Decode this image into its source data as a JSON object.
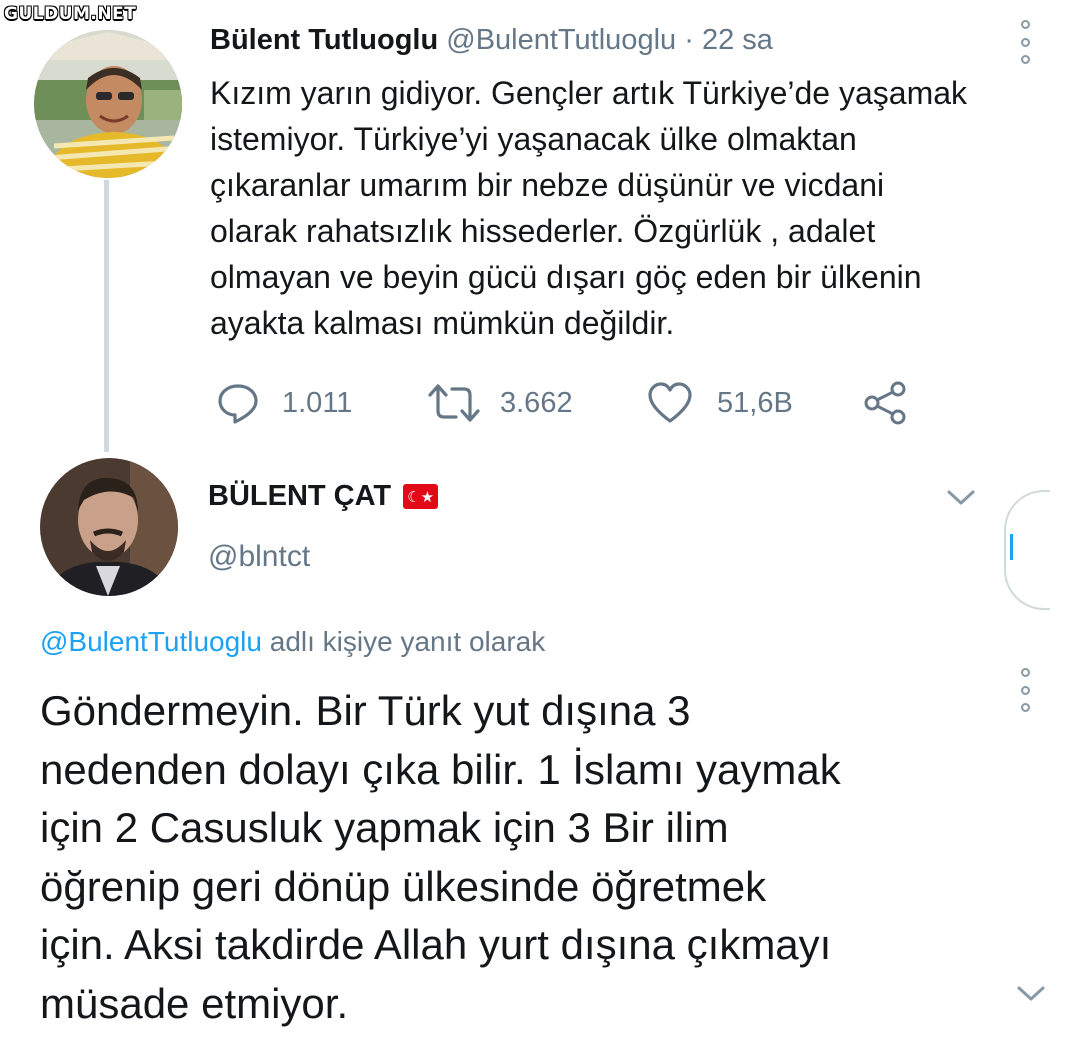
{
  "watermark": "GULDUM.NET",
  "tweet1": {
    "display_name": "Bülent Tutluoglu",
    "handle": "@BulentTutluoglu",
    "separator": "·",
    "time": "22 sa",
    "text_lines": [
      "Kızım yarın gidiyor. Gençler artık Türkiye’de yaşamak",
      "istemiyor. Türkiye’yi yaşanacak ülke olmaktan",
      "çıkaranlar umarım bir nebze düşünür ve vicdani",
      "olarak rahatsızlık hissederler. Özgürlük , adalet",
      "olmayan ve beyin gücü dışarı göç eden bir ülkenin",
      "ayakta kalması mümkün değildir."
    ],
    "replies": "1.011",
    "retweets": "3.662",
    "likes": "51,6B"
  },
  "tweet2": {
    "display_name": "BÜLENT ÇAT",
    "flag_icon": "turkey-flag-icon",
    "handle": "@blntct",
    "reply_prefix_mention": "@BulentTutluoglu",
    "reply_prefix_text": " adlı kişiye yanıt olarak",
    "text_lines": [
      "Göndermeyin. Bir Türk yut dışına 3",
      "nedenden dolayı çıka bilir. 1 İslamı yaymak",
      "için 2  Casusluk yapmak için 3 Bir ilim",
      "öğrenip geri dönüp ülkesinde öğretmek",
      "için. Aksi takdirde Allah yurt dışına çıkmayı",
      "müsade etmiyor."
    ]
  },
  "colors": {
    "accent": "#1da1f2",
    "secondary_text": "#657786",
    "primary_text": "#14171a",
    "thread_line": "#cfd9de",
    "flag_red": "#e30a17"
  }
}
